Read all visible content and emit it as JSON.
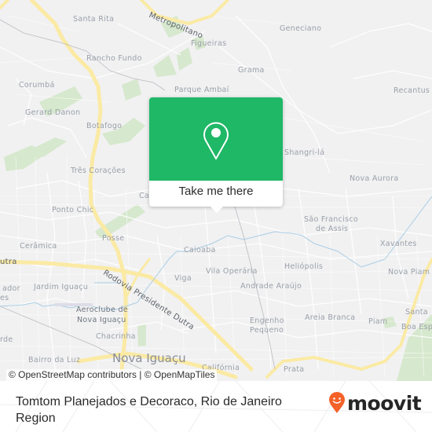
{
  "map": {
    "labels": {
      "metropolitano": "Metropolitano",
      "santa_rita": "Santa Rita",
      "geneciano": "Geneciano",
      "figueiras": "Figueiras",
      "rancho_fundo": "Rancho Fundo",
      "grama": "Grama",
      "corumba": "Corumbá",
      "parque_ambai": "Parque Ambaí",
      "recantus": "Recantus",
      "gerard_danon": "Gerard Danon",
      "botafogo": "Botafogo",
      "shangri_la": "Shangri-lá",
      "tres_coracoes": "Três Corações",
      "nova_aurora": "Nova Aurora",
      "ca": "Ca",
      "ponto_chic": "Ponto Chic",
      "sao_francisco_1": "São Francisco",
      "sao_francisco_2": "de Assis",
      "posse": "Posse",
      "caioaba": "Caioaba",
      "xavantes": "Xavantes",
      "ceramica": "Cerâmica",
      "heliopolis": "Heliópolis",
      "dutra_fragment": "utra",
      "nova_piam": "Nova Piam",
      "ador": "ador",
      "es": "es",
      "jardim_iguacu": "Jardim Iguaçu",
      "viga": "Viga",
      "vila_operaria": "Vila Operária",
      "andrade_araujo": "Andrade Araújo",
      "rodovia": "Rodovia Presidente Dutra",
      "aeroclube_1": "Aeroclube de",
      "aeroclube_2": "Nova Iguaçu",
      "santa": "Santa",
      "boa_esp": "Boa Esp",
      "areia_branca": "Areia Branca",
      "piam": "Piam",
      "engenho_1": "Engenho",
      "engenho_2": "Pequeno",
      "rde": "rde",
      "chacrinha": "Chacrinha",
      "bairro_da_luz": "Bairro da Luz",
      "nova_iguacu": "Nova Iguaçu",
      "california": "Califórnia",
      "prata": "Prata"
    },
    "attribution": "© OpenStreetMap contributors | © OpenMapTiles"
  },
  "popup": {
    "icon": "map-pin-icon",
    "button_label": "Take me there",
    "color": "#1fb866"
  },
  "footer": {
    "place_title": "Tomtom Planejados e Decoraco, Rio de Janeiro Region",
    "logo_text": "moovit",
    "logo_icon": "moovit-pin-smile-icon",
    "logo_color": "#f4622a"
  }
}
